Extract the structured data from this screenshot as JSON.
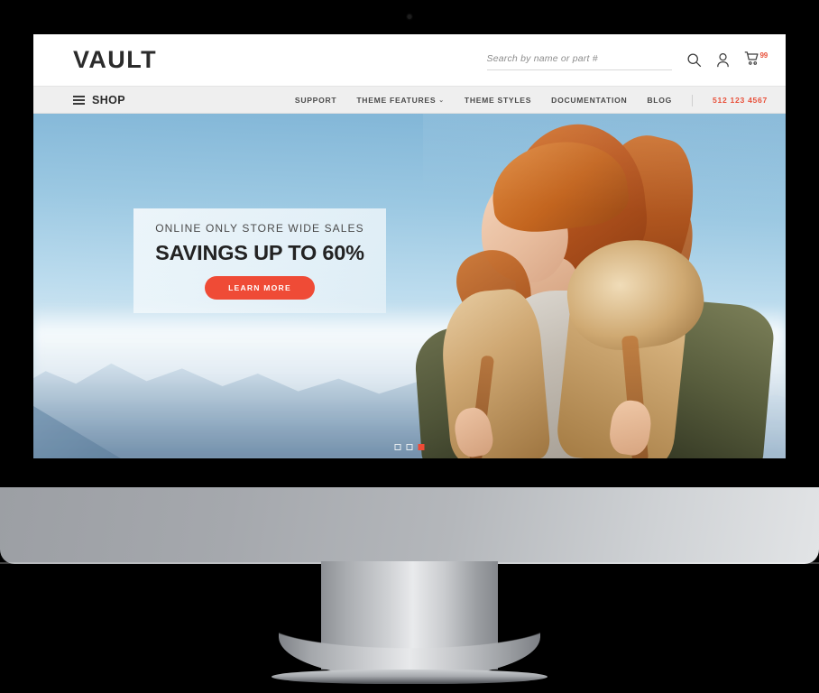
{
  "device": {
    "type": "desktop-monitor"
  },
  "site": {
    "brand": "VAULT",
    "header": {
      "search": {
        "placeholder": "Search by name or part #",
        "value": ""
      },
      "icons": {
        "search": "search-icon",
        "account": "user-icon",
        "cart": "cart-icon"
      },
      "cart_badge": "99"
    },
    "nav": {
      "shop_label": "SHOP",
      "menu_icon": "hamburger-icon",
      "links": [
        {
          "label": "SUPPORT",
          "has_dropdown": false
        },
        {
          "label": "THEME FEATURES",
          "has_dropdown": true,
          "chevron": "⌄"
        },
        {
          "label": "THEME STYLES",
          "has_dropdown": false
        },
        {
          "label": "DOCUMENTATION",
          "has_dropdown": false
        },
        {
          "label": "BLOG",
          "has_dropdown": false
        }
      ],
      "phone": "512 123 4567"
    },
    "hero": {
      "kicker": "ONLINE ONLY STORE WIDE SALES",
      "title": "SAVINGS UP TO 60%",
      "cta_label": "LEARN MORE",
      "carousel": {
        "total": 3,
        "active_index": 2
      }
    }
  },
  "colors": {
    "accent_red": "#ef4b36",
    "phone_red": "#e8503a",
    "nav_background": "#efefef",
    "header_background": "#ffffff",
    "text_dark": "#2b2b2b",
    "bezel": "#000000",
    "chin_silver": "#b4b7bb"
  }
}
